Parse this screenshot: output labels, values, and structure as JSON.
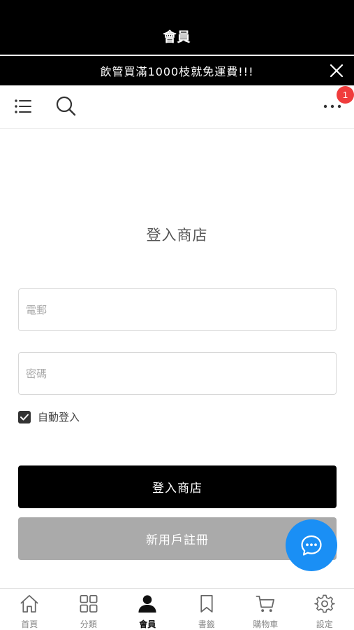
{
  "header": {
    "title": "會員"
  },
  "promo": {
    "text": "飲管買滿1000枝就免運費!!!"
  },
  "navbar": {
    "badge_count": "1"
  },
  "login": {
    "title": "登入商店",
    "email_placeholder": "電郵",
    "password_placeholder": "密碼",
    "remember_label": "自動登入",
    "remember_checked": true,
    "login_button": "登入商店",
    "register_button": "新用戶註冊"
  },
  "tabbar": {
    "items": [
      {
        "label": "首頁",
        "icon": "home-icon"
      },
      {
        "label": "分類",
        "icon": "grid-icon"
      },
      {
        "label": "會員",
        "icon": "user-icon",
        "active": true
      },
      {
        "label": "書籤",
        "icon": "bookmark-icon"
      },
      {
        "label": "購物車",
        "icon": "cart-icon"
      },
      {
        "label": "設定",
        "icon": "gear-icon"
      }
    ]
  },
  "colors": {
    "chat": "#1a8ff5",
    "badge": "#f03c3c",
    "primary": "#000000",
    "secondary": "#aaaaaa"
  }
}
